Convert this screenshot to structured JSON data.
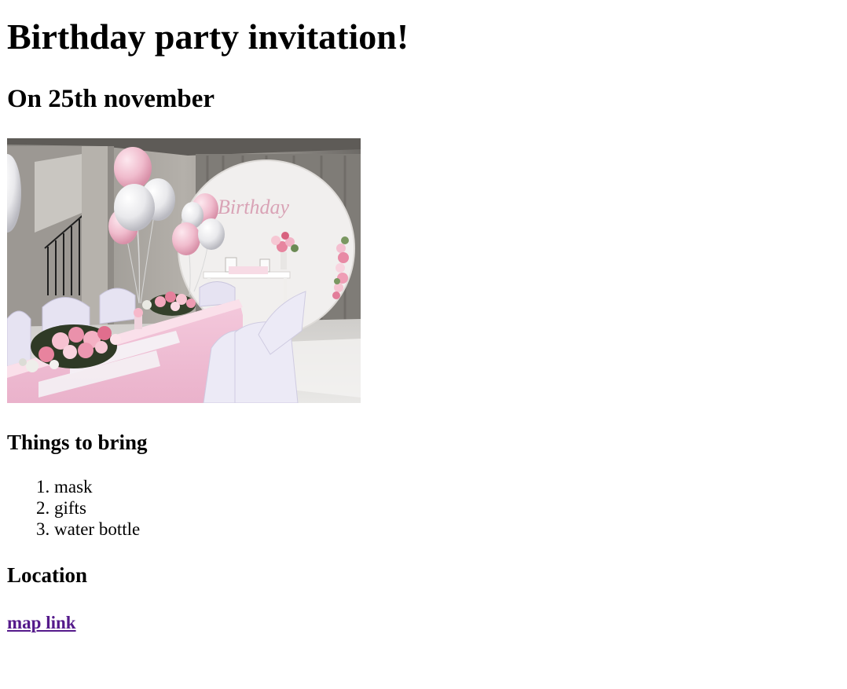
{
  "page": {
    "title": "Birthday party invitation!",
    "date_heading": "On 25th november"
  },
  "photo": {
    "description": "decorated birthday party room",
    "sign_text": "Birthday"
  },
  "bring": {
    "heading": "Things to bring",
    "items": [
      "mask",
      "gifts",
      "water bottle"
    ]
  },
  "location": {
    "heading": "Location",
    "link_text": "map link",
    "link_color": "#551a8b"
  }
}
